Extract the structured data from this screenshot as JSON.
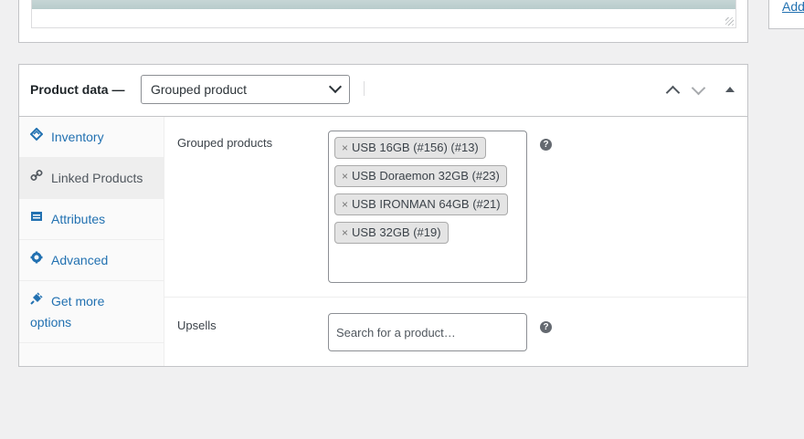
{
  "side": {
    "link_label": "Add"
  },
  "panel": {
    "title": "Product data —",
    "product_type": "Grouped product"
  },
  "tabs": [
    {
      "label": "Inventory",
      "icon": "inventory-icon"
    },
    {
      "label": "Linked Products",
      "icon": "link-icon",
      "active": true
    },
    {
      "label": "Attributes",
      "icon": "attributes-icon"
    },
    {
      "label": "Advanced",
      "icon": "gear-icon"
    },
    {
      "label": "Get more",
      "label2": "options",
      "icon": "plugin-icon"
    }
  ],
  "fields": {
    "grouped_label": "Grouped products",
    "grouped_products": [
      "USB 16GB (#156) (#13)",
      "USB Doraemon 32GB (#23)",
      "USB IRONMAN 64GB (#21)",
      "USB 32GB (#19)"
    ],
    "upsells_label": "Upsells",
    "upsells_placeholder": "Search for a product…",
    "help_glyph": "?"
  },
  "colors": {
    "link": "#2271b1",
    "border": "#c3c4c7",
    "background": "#f0f0f1"
  }
}
